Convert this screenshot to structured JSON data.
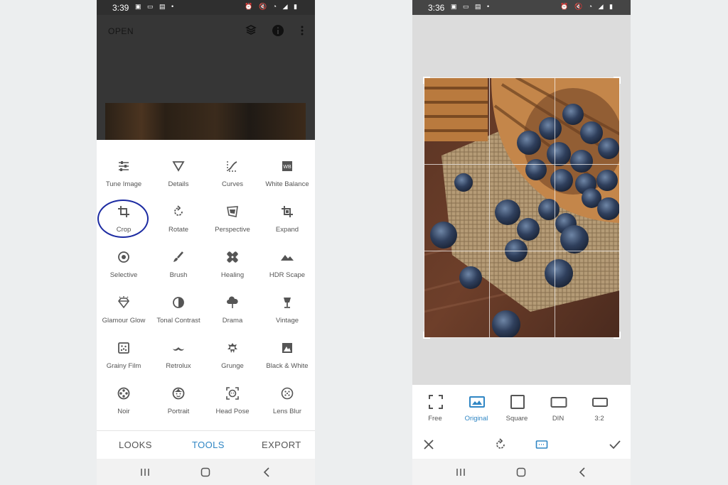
{
  "left_screen": {
    "status": {
      "time": "3:39",
      "left_icons": "▣ ▭ ▤ •",
      "right_icons": "⏰ 🔇 ◔ ◢ ▮"
    },
    "header": {
      "open_label": "OPEN"
    },
    "tools": [
      {
        "label": "Tune Image",
        "icon": "sliders-icon"
      },
      {
        "label": "Details",
        "icon": "triangle-down-icon"
      },
      {
        "label": "Curves",
        "icon": "curves-icon"
      },
      {
        "label": "White Balance",
        "icon": "white-balance-icon"
      },
      {
        "label": "Crop",
        "icon": "crop-icon"
      },
      {
        "label": "Rotate",
        "icon": "rotate-icon"
      },
      {
        "label": "Perspective",
        "icon": "perspective-icon"
      },
      {
        "label": "Expand",
        "icon": "expand-icon"
      },
      {
        "label": "Selective",
        "icon": "selective-icon"
      },
      {
        "label": "Brush",
        "icon": "brush-icon"
      },
      {
        "label": "Healing",
        "icon": "healing-icon"
      },
      {
        "label": "HDR Scape",
        "icon": "mountains-icon"
      },
      {
        "label": "Glamour Glow",
        "icon": "diamond-icon"
      },
      {
        "label": "Tonal Contrast",
        "icon": "tonal-contrast-icon"
      },
      {
        "label": "Drama",
        "icon": "cloud-rain-icon"
      },
      {
        "label": "Vintage",
        "icon": "lamp-icon"
      },
      {
        "label": "Grainy Film",
        "icon": "film-grain-icon"
      },
      {
        "label": "Retrolux",
        "icon": "mustache-icon"
      },
      {
        "label": "Grunge",
        "icon": "grunge-icon"
      },
      {
        "label": "Black & White",
        "icon": "black-white-icon"
      },
      {
        "label": "Noir",
        "icon": "film-reel-icon"
      },
      {
        "label": "Portrait",
        "icon": "face-icon"
      },
      {
        "label": "Head Pose",
        "icon": "head-pose-icon"
      },
      {
        "label": "Lens Blur",
        "icon": "lens-blur-icon"
      }
    ],
    "tabs": [
      {
        "label": "LOOKS",
        "active": false
      },
      {
        "label": "TOOLS",
        "active": true
      },
      {
        "label": "EXPORT",
        "active": false
      }
    ]
  },
  "right_screen": {
    "status": {
      "time": "3:36",
      "left_icons": "▣ ▭ ▤ •",
      "right_icons": "⏰ 🔇 ◔ ◢ ▮"
    },
    "aspect_options": [
      {
        "label": "Free",
        "icon": "free-crop-icon",
        "active": false
      },
      {
        "label": "Original",
        "icon": "image-icon",
        "active": true
      },
      {
        "label": "Square",
        "icon": "square-icon",
        "active": false
      },
      {
        "label": "DIN",
        "icon": "din-rect-icon",
        "active": false
      },
      {
        "label": "3:2",
        "icon": "ratio-3-2-icon",
        "active": false
      }
    ]
  },
  "colors": {
    "accent": "#2f86c4",
    "annotation": "#1c2ba2",
    "icon_gray": "#555555"
  }
}
